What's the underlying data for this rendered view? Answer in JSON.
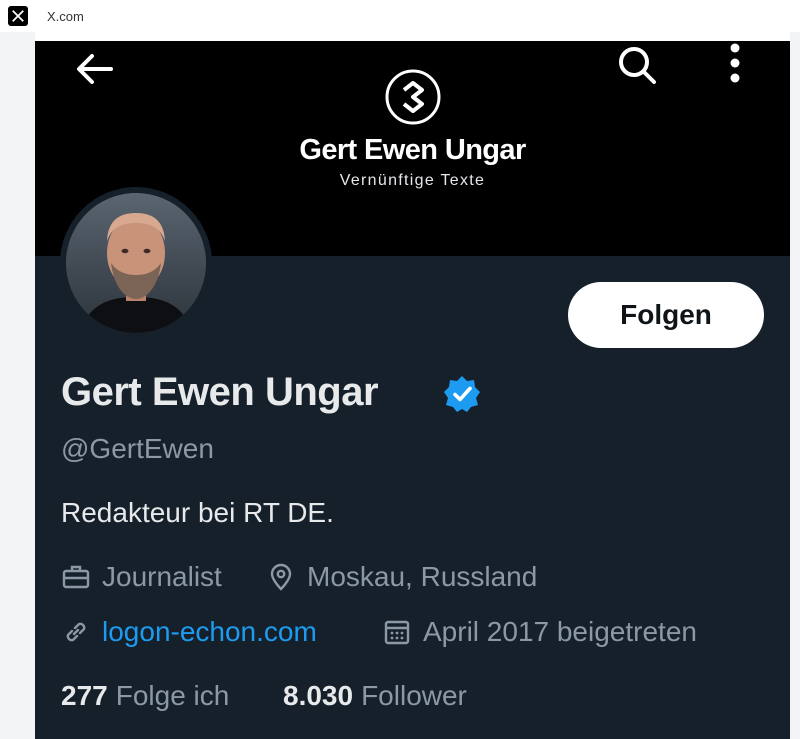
{
  "browser": {
    "tab_title": "X.com",
    "favicon": "x-logo-icon"
  },
  "header": {
    "back_icon": "arrow-left-icon",
    "search_icon": "search-icon",
    "more_icon": "more-vertical-icon"
  },
  "banner": {
    "logo": "brand-logo-icon",
    "title": "Gert Ewen Ungar",
    "subtitle": "Vernünftige Texte"
  },
  "profile": {
    "name": "Gert Ewen Ungar",
    "handle": "@GertEwen",
    "bio": "Redakteur bei RT DE.",
    "follow_label": "Folgen",
    "job": "Journalist",
    "location": "Moskau, Russland",
    "website": "logon-echon.com",
    "joined": "April 2017 beigetreten",
    "following_count": "277",
    "following_label": "Folge ich",
    "followers_count": "8.030",
    "followers_label": "Follower"
  },
  "colors": {
    "background": "#15202b",
    "banner": "#000000",
    "accent": "#1d9bf0",
    "text": "#e7e9ea",
    "muted": "#8b98a5"
  }
}
